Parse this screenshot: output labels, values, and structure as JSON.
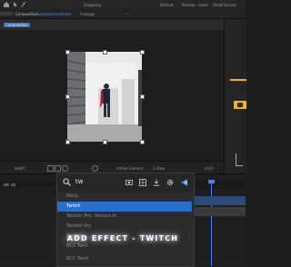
{
  "toolbar": {
    "snapping_label": "Snapping",
    "default_label": "Default",
    "review_label": "Review",
    "learn_label": "Learn",
    "small_screen_label": "Small Screen"
  },
  "composition": {
    "tab_label": "Composition",
    "comp_name": "Composition Name",
    "footage_label": "Footage",
    "breadcrumb": "Composition",
    "viewer_controls": {
      "zoom": "(Half)",
      "camera": "Active Camera",
      "view": "1 View",
      "offset": "+0.0"
    }
  },
  "effects": {
    "search_value": "tw",
    "items": [
      {
        "label": "Warp"
      },
      {
        "label": "Twitch"
      },
      {
        "label": "Twixtor Pro, Vectors In"
      },
      {
        "label": "Twixtor Pro"
      },
      {
        "label": "Twixtor"
      },
      {
        "label": "BCC Twirl"
      },
      {
        "label": "BCC Twist"
      }
    ]
  },
  "caption": "ADD EFFECT - TWITCH",
  "colors": {
    "accent": "#2a6fc9",
    "highlight": "#3a7ad8",
    "yellow": "#f2b705",
    "timeline_marker": "#4a7dff"
  }
}
